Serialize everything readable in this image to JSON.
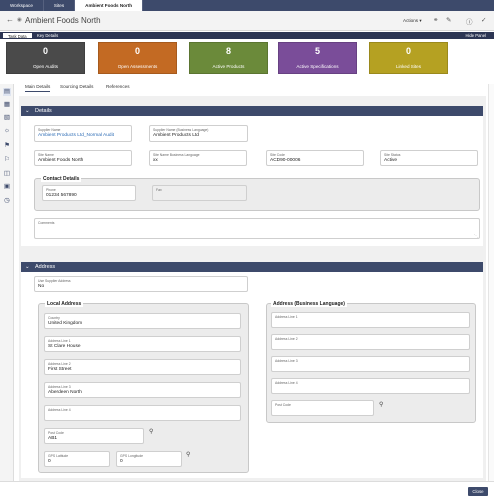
{
  "topbar": {
    "tabs": [
      {
        "label": "Workspace"
      },
      {
        "label": "Sites"
      },
      {
        "label": "Ambient Foods North"
      }
    ]
  },
  "titlebar": {
    "title": "Ambient Foods North",
    "actions_label": "Actions"
  },
  "subbar": {
    "task_data": "Task Data",
    "key_details": "Key Details",
    "hide_panel": "Hide Panel"
  },
  "kpis": [
    {
      "value": "0",
      "label": "Open Audits",
      "color": "#4a4a4a"
    },
    {
      "value": "0",
      "label": "Open Assessments",
      "color": "#c36a23"
    },
    {
      "value": "8",
      "label": "Active Products",
      "color": "#6b8a3a"
    },
    {
      "value": "5",
      "label": "Active Specifications",
      "color": "#7a4d99"
    },
    {
      "value": "0",
      "label": "Linked Sites",
      "color": "#b5a122"
    }
  ],
  "tabs": {
    "main": "Main Details",
    "sourcing": "Sourcing Details",
    "references": "References"
  },
  "details": {
    "title": "Details",
    "supplier_name": {
      "label": "Supplier Name",
      "value": "Ambient Products Ltd_Normal Audit"
    },
    "supplier_name_bl": {
      "label": "Supplier Name (Business Language)",
      "value": "Ambient Products Ltd"
    },
    "site_name": {
      "label": "Site Name",
      "value": "Ambient Foods North"
    },
    "site_name_bl": {
      "label": "Site Name Business Language",
      "value": "xx"
    },
    "site_code": {
      "label": "Site Code",
      "value": "ACD90-00006"
    },
    "site_status": {
      "label": "Site Status",
      "value": "Active"
    },
    "contact": {
      "title": "Contact Details",
      "phone": {
        "label": "Phone",
        "value": "01234 567890"
      },
      "fax": {
        "label": "Fax",
        "value": ""
      }
    },
    "comments": {
      "label": "Comments",
      "value": ""
    }
  },
  "address": {
    "title": "Address",
    "use_supplier": {
      "label": "Use Supplier Address",
      "value": "No"
    },
    "local": {
      "title": "Local Address",
      "country": {
        "label": "Country",
        "value": "United Kingdom"
      },
      "line1": {
        "label": "Address Line 1",
        "value": "St Clare House"
      },
      "line2": {
        "label": "Address Line 2",
        "value": "First Street"
      },
      "line3": {
        "label": "Address Line 3",
        "value": "Aberdeen North"
      },
      "line4": {
        "label": "Address Line 4",
        "value": ""
      },
      "post_code": {
        "label": "Post Code",
        "value": "AB1"
      },
      "gps_lat": {
        "label": "GPS Latitude",
        "value": "0"
      },
      "gps_long": {
        "label": "GPS Longitude",
        "value": "0"
      }
    },
    "business": {
      "title": "Address (Business Language)",
      "line1": {
        "label": "Address Line 1",
        "value": ""
      },
      "line2": {
        "label": "Address Line 2",
        "value": ""
      },
      "line3": {
        "label": "Address Line 3",
        "value": ""
      },
      "line4": {
        "label": "Address Line 4",
        "value": ""
      },
      "post_code": {
        "label": "Post Code",
        "value": ""
      }
    }
  },
  "footer": {
    "close": "Close"
  }
}
